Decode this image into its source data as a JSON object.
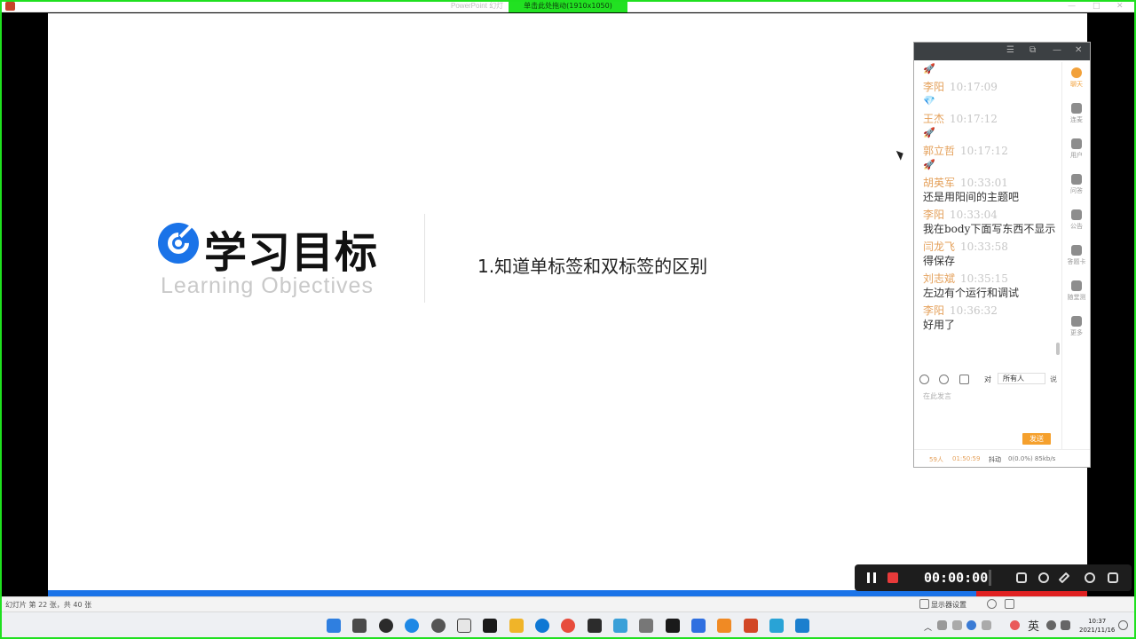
{
  "window": {
    "title": "PowerPoint 幻灯",
    "drag_tag": "单击此处拖动(1910x1050)"
  },
  "slide": {
    "heading": "学习目标",
    "subheading": "Learning Objectives",
    "objective": "1.知道单标签和双标签的区别"
  },
  "statusbar": {
    "slide_count": "幻灯片 第 22 张，共 40 张",
    "display_settings": "显示器设置"
  },
  "chat": {
    "messages": [
      {
        "emoji": "🚀"
      },
      {
        "name": "李阳",
        "time": "10:17:09",
        "emoji": "💎"
      },
      {
        "name": "王杰",
        "time": "10:17:12",
        "emoji": "🚀"
      },
      {
        "name": "郭立哲",
        "time": "10:17:12",
        "emoji": "🚀"
      },
      {
        "name": "胡英军",
        "time": "10:33:01",
        "text": "还是用阳间的主题吧"
      },
      {
        "name": "李阳",
        "time": "10:33:04",
        "text": "我在body下面写东西不显示"
      },
      {
        "name": "闫龙飞",
        "time": "10:33:58",
        "text": "得保存"
      },
      {
        "name": "刘志斌",
        "time": "10:35:15",
        "text": "左边有个运行和调试"
      },
      {
        "name": "李阳",
        "time": "10:36:32",
        "text": "好用了"
      }
    ],
    "side_menu": [
      "聊天",
      "连麦",
      "用户",
      "问答",
      "公告",
      "答题卡",
      "随堂测",
      "更多"
    ],
    "to_label": "对",
    "recipient": "所有人",
    "say_label": "说",
    "input_placeholder": "在此发言",
    "send_label": "发送",
    "footer": {
      "users": "59人",
      "duration": "01:50:59",
      "lag": "抖动",
      "network": "0(0.0%) 85kb/s"
    }
  },
  "recorder": {
    "timer": "00:00:00"
  },
  "taskbar": {
    "ime": "英",
    "time": "10:37",
    "date": "2021/11/16"
  },
  "colors": {
    "accent_blue": "#1a73e8",
    "chat_name": "#e4a05a",
    "send_button": "#f5a02d",
    "frame_green": "#1fe01f"
  }
}
